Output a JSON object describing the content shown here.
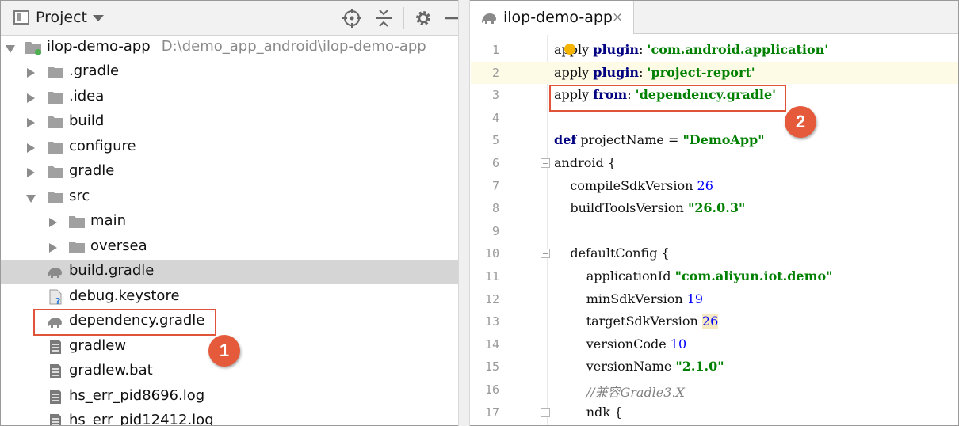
{
  "project_panel": {
    "title": "Project",
    "root": {
      "label": "ilop-demo-app",
      "path": "D:\\demo_app_android\\ilop-demo-app"
    },
    "items": [
      {
        "label": ".gradle"
      },
      {
        "label": ".idea"
      },
      {
        "label": "build"
      },
      {
        "label": "configure"
      },
      {
        "label": "gradle"
      },
      {
        "label": "src"
      },
      {
        "label": "main"
      },
      {
        "label": "oversea"
      },
      {
        "label": "build.gradle"
      },
      {
        "label": "debug.keystore"
      },
      {
        "label": "dependency.gradle"
      },
      {
        "label": "gradlew"
      },
      {
        "label": "gradlew.bat"
      },
      {
        "label": "hs_err_pid8696.log"
      },
      {
        "label": "hs_err_pid12412.log"
      }
    ]
  },
  "editor": {
    "tab_label": "ilop-demo-app",
    "tab_close": "×",
    "lines": [
      {
        "no": "1",
        "parts": [
          [
            "apply ",
            ""
          ],
          [
            "plugin",
            "kw"
          ],
          [
            ": ",
            ""
          ],
          [
            "'com.android.application'",
            "str"
          ]
        ]
      },
      {
        "no": "2",
        "parts": [
          [
            "apply ",
            ""
          ],
          [
            "plugin",
            "kw"
          ],
          [
            ": ",
            ""
          ],
          [
            "'project-report'",
            "str"
          ]
        ]
      },
      {
        "no": "3",
        "parts": [
          [
            "apply ",
            ""
          ],
          [
            "from",
            "kw"
          ],
          [
            ": ",
            ""
          ],
          [
            "'dependency.gradle'",
            "str"
          ]
        ]
      },
      {
        "no": "4",
        "parts": []
      },
      {
        "no": "5",
        "parts": [
          [
            "def",
            "kw"
          ],
          [
            " projectName = ",
            ""
          ],
          [
            "\"DemoApp\"",
            "str"
          ]
        ]
      },
      {
        "no": "6",
        "parts": [
          [
            "android {",
            ""
          ]
        ]
      },
      {
        "no": "7",
        "parts": [
          [
            "    compileSdkVersion ",
            ""
          ],
          [
            "26",
            "num"
          ]
        ]
      },
      {
        "no": "8",
        "parts": [
          [
            "    buildToolsVersion ",
            ""
          ],
          [
            "\"26.0.3\"",
            "str"
          ]
        ]
      },
      {
        "no": "9",
        "parts": []
      },
      {
        "no": "10",
        "parts": [
          [
            "    defaultConfig {",
            ""
          ]
        ]
      },
      {
        "no": "11",
        "parts": [
          [
            "        applicationId ",
            ""
          ],
          [
            "\"com.aliyun.iot.demo\"",
            "str"
          ]
        ]
      },
      {
        "no": "12",
        "parts": [
          [
            "        minSdkVersion ",
            ""
          ],
          [
            "19",
            "num"
          ]
        ]
      },
      {
        "no": "13",
        "parts": [
          [
            "        targetSdkVersion ",
            ""
          ],
          [
            "26",
            "num hl-num"
          ]
        ]
      },
      {
        "no": "14",
        "parts": [
          [
            "        versionCode ",
            ""
          ],
          [
            "10",
            "num"
          ]
        ]
      },
      {
        "no": "15",
        "parts": [
          [
            "        versionName ",
            ""
          ],
          [
            "\"2.1.0\"",
            "str"
          ]
        ]
      },
      {
        "no": "16",
        "parts": [
          [
            "        //兼容Gradle3.X",
            "cmt"
          ]
        ]
      },
      {
        "no": "17",
        "parts": [
          [
            "        ndk {",
            ""
          ]
        ]
      }
    ]
  },
  "callouts": {
    "badge_1": "1",
    "badge_2": "2"
  },
  "colors": {
    "callout": "#e2543a",
    "keyword": "#000080",
    "string": "#008000",
    "number": "#0000ff"
  }
}
